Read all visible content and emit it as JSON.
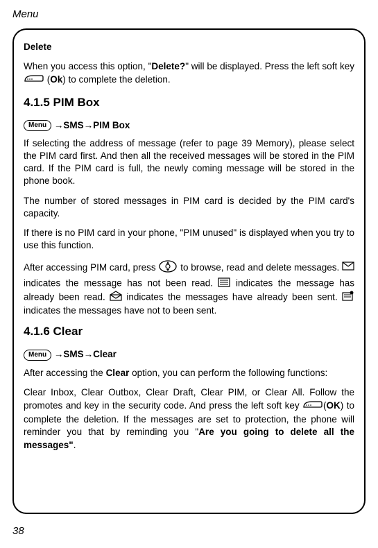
{
  "header": "Menu",
  "page_number": "38",
  "section_delete": {
    "title": "Delete",
    "p1_pre": "When you access this option, \"",
    "p1_bold": "Delete?",
    "p1_post": "\" will be displayed. Press the left soft key ",
    "p1_tail_pre": " (",
    "p1_tail_bold": "Ok",
    "p1_tail_post": ") to complete the deletion."
  },
  "section_pim": {
    "heading": "4.1.5 PIM Box",
    "menu_label": "Menu",
    "arrow": "→",
    "bc_sms": "SMS",
    "bc_pim": "PIM Box",
    "p1": "If selecting the address of message (refer to page 39 Memory), please select the PIM card first. And then all the received messages will be stored in the PIM card. If the PIM card is full, the newly coming message will be stored in the phone book.",
    "p2": "The number of stored messages in PIM card is decided by the PIM card's capacity.",
    "p3": "If there is no PIM card in your phone, \"PIM unused\" is displayed when you try to use this function.",
    "p4_a": "After accessing PIM card, press ",
    "p4_b": " to browse, read and delete messages. ",
    "p4_c": " indicates the message has not been read. ",
    "p4_d": " indicates the message has already been read. ",
    "p4_e": " indicates the messages have already been sent. ",
    "p4_f": " indicates the messages have not to been sent."
  },
  "section_clear": {
    "heading": "4.1.6 Clear",
    "menu_label": "Menu",
    "bc_sms": "SMS",
    "bc_clear": "Clear",
    "p1_pre": "After accessing the ",
    "p1_bold": "Clear",
    "p1_post": " option, you can perform the following functions:",
    "p2_a": "Clear Inbox, Clear Outbox, Clear Draft, Clear PIM, or Clear All. Follow the promotes and key in the security code. And press the left soft key ",
    "p2_b_pre": "(",
    "p2_b_bold": "OK",
    "p2_b_post": ") to complete the deletion. If the messages are set to protection, the phone will reminder you that by reminding you \"",
    "p2_c_bold": "Are you going to delete all the messages\"",
    "p2_c_post": "."
  }
}
